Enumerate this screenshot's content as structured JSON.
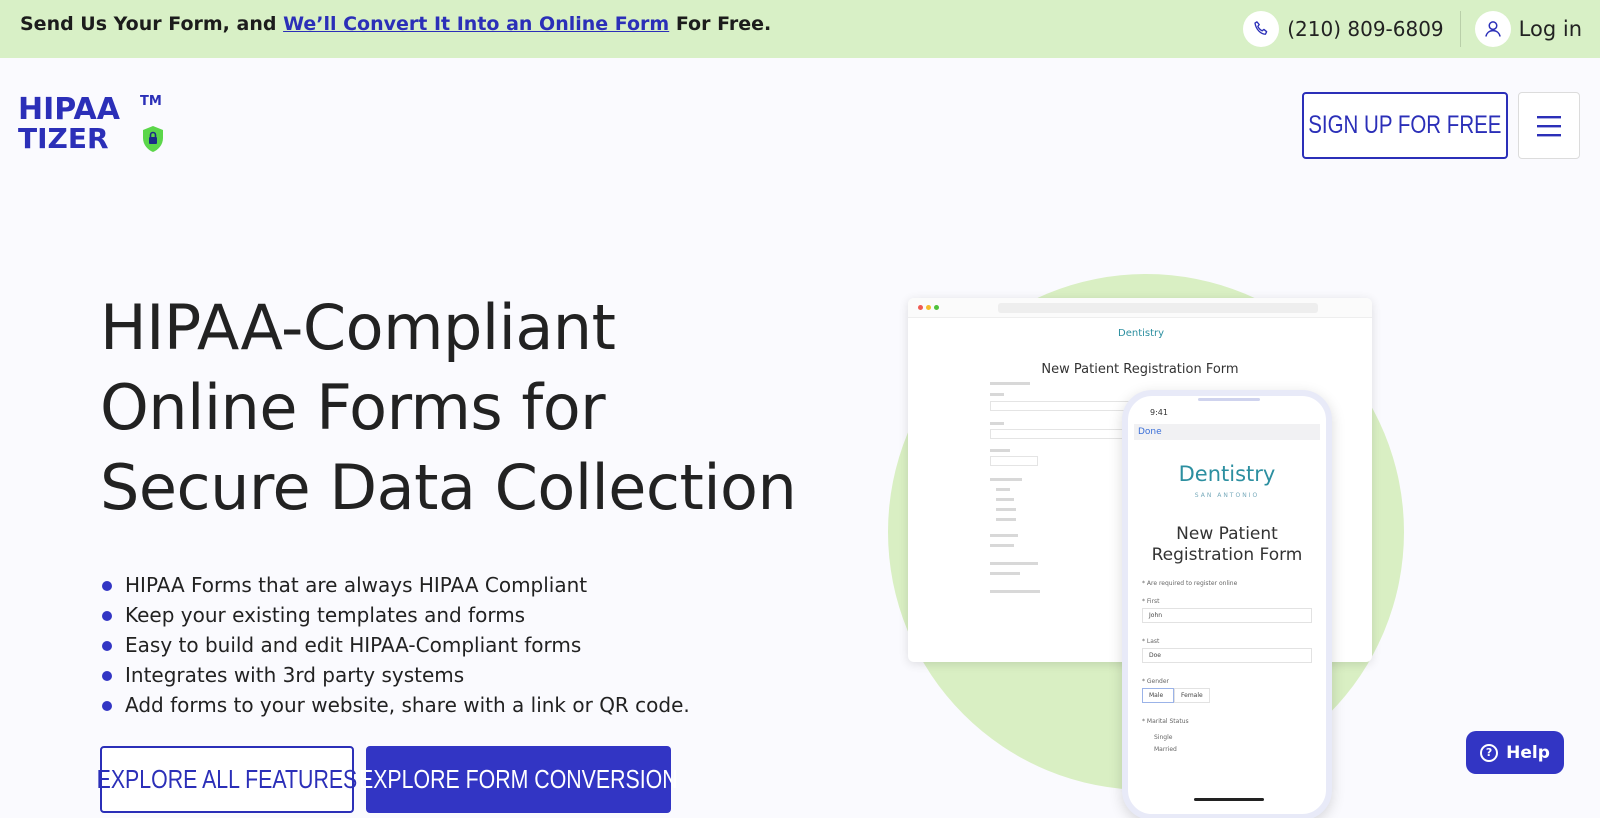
{
  "topbar": {
    "promo_prefix": "Send Us Your Form, and ",
    "promo_link": "We’ll Convert It Into an Online Form",
    "promo_suffix": " For Free.",
    "phone": "(210) 809-6809",
    "login": "Log in"
  },
  "header": {
    "logo_line1": "HIPAA",
    "logo_line2": "TIZER",
    "logo_tm": "TM",
    "signup": "SIGN UP FOR FREE"
  },
  "hero": {
    "line1": "HIPAA-Compliant",
    "line2": "Online Forms for",
    "line3": "Secure Data Collection"
  },
  "bullets": [
    "HIPAA Forms that are always HIPAA Compliant",
    "Keep your existing templates and forms",
    "Easy to build and edit HIPAA-Compliant forms",
    "Integrates with 3rd party systems",
    "Add forms to your website, share with a link or QR code."
  ],
  "buttons": {
    "features": "EXPLORE ALL FEATURES",
    "conversion": "EXPLORE FORM CONVERSION"
  },
  "illustration": {
    "browser_logo": "Dentistry",
    "browser_title": "New Patient Registration Form",
    "phone_time": "9:41",
    "phone_done": "Done",
    "phone_logo": "Dentistry",
    "phone_logo_sub": "SAN ANTONIO",
    "phone_title_1": "New Patient",
    "phone_title_2": "Registration Form",
    "phone_required": "* Are required to register online",
    "first_label": "* First",
    "first_value": "John",
    "last_label": "* Last",
    "last_value": "Doe",
    "gender_label": "* Gender",
    "gender_male": "Male",
    "gender_female": "Female",
    "marital_label": "* Marital Status",
    "marital_single": "Single",
    "marital_married": "Married"
  },
  "help": "Help",
  "icons": {
    "phone": "phone-icon",
    "user": "user-icon",
    "menu": "hamburger-menu-icon",
    "help": "question-circle-icon"
  },
  "colors": {
    "brand_blue": "#3235c4",
    "banner_green": "#d8f0c6",
    "circle_green": "#d9efc3"
  }
}
